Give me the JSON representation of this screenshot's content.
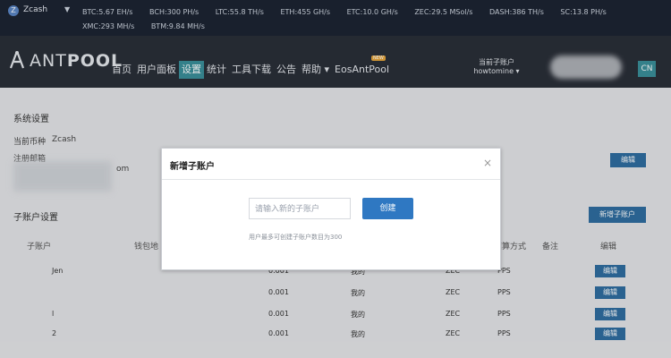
{
  "topbar": {
    "coin": "Zcash",
    "ticker": [
      "BTC:5.67 EH/s",
      "BCH:300 PH/s",
      "LTC:55.8 TH/s",
      "ETH:455 GH/s",
      "ETC:10.0 GH/s",
      "ZEC:29.5 MSol/s",
      "DASH:386 TH/s",
      "SC:13.8 PH/s",
      "XMC:293 MH/s",
      "BTM:9.84 MH/s"
    ]
  },
  "nav": {
    "logo_ant": "ANT",
    "logo_pool": "POOL",
    "items": [
      {
        "label": "首页"
      },
      {
        "label": "用户面板"
      },
      {
        "label": "设置"
      },
      {
        "label": "统计"
      },
      {
        "label": "工具下载"
      },
      {
        "label": "公告"
      },
      {
        "label": "帮助 ▾"
      },
      {
        "label": "EosAntPool"
      }
    ],
    "eos_badge": "NEW",
    "account_label": "当前子账户",
    "account_name": "howtomine ▾",
    "lang": "CN"
  },
  "page": {
    "system_settings": "系统设置",
    "current_coin_label": "当前币种",
    "current_coin_value": "Zcash",
    "email_label": "注册邮箱",
    "email_suffix": "om",
    "edit_label": "编辑",
    "subaccount_settings": "子账户设置",
    "new_subaccount_button": "新增子账户",
    "table_headers": [
      "子账户",
      "钱包地",
      "结算方式",
      "备注",
      "编辑"
    ],
    "rows": [
      {
        "name": "Jen",
        "value": "0.001",
        "owner": "我的",
        "coin": "ZEC",
        "method": "PPS",
        "edit": "编辑"
      },
      {
        "name": "",
        "value": "0.001",
        "owner": "我的",
        "coin": "ZEC",
        "method": "PPS",
        "edit": "编辑"
      },
      {
        "name": "l",
        "value": "0.001",
        "owner": "我的",
        "coin": "ZEC",
        "method": "PPS",
        "edit": "编辑"
      },
      {
        "name": "2",
        "value": "0.001",
        "owner": "我的",
        "coin": "ZEC",
        "method": "PPS",
        "edit": "编辑"
      }
    ]
  },
  "modal": {
    "title": "新增子账户",
    "input_placeholder": "请输入新的子账户",
    "create_button": "创建",
    "hint": "用户最多可创建子账户数目为300",
    "close": "×"
  }
}
